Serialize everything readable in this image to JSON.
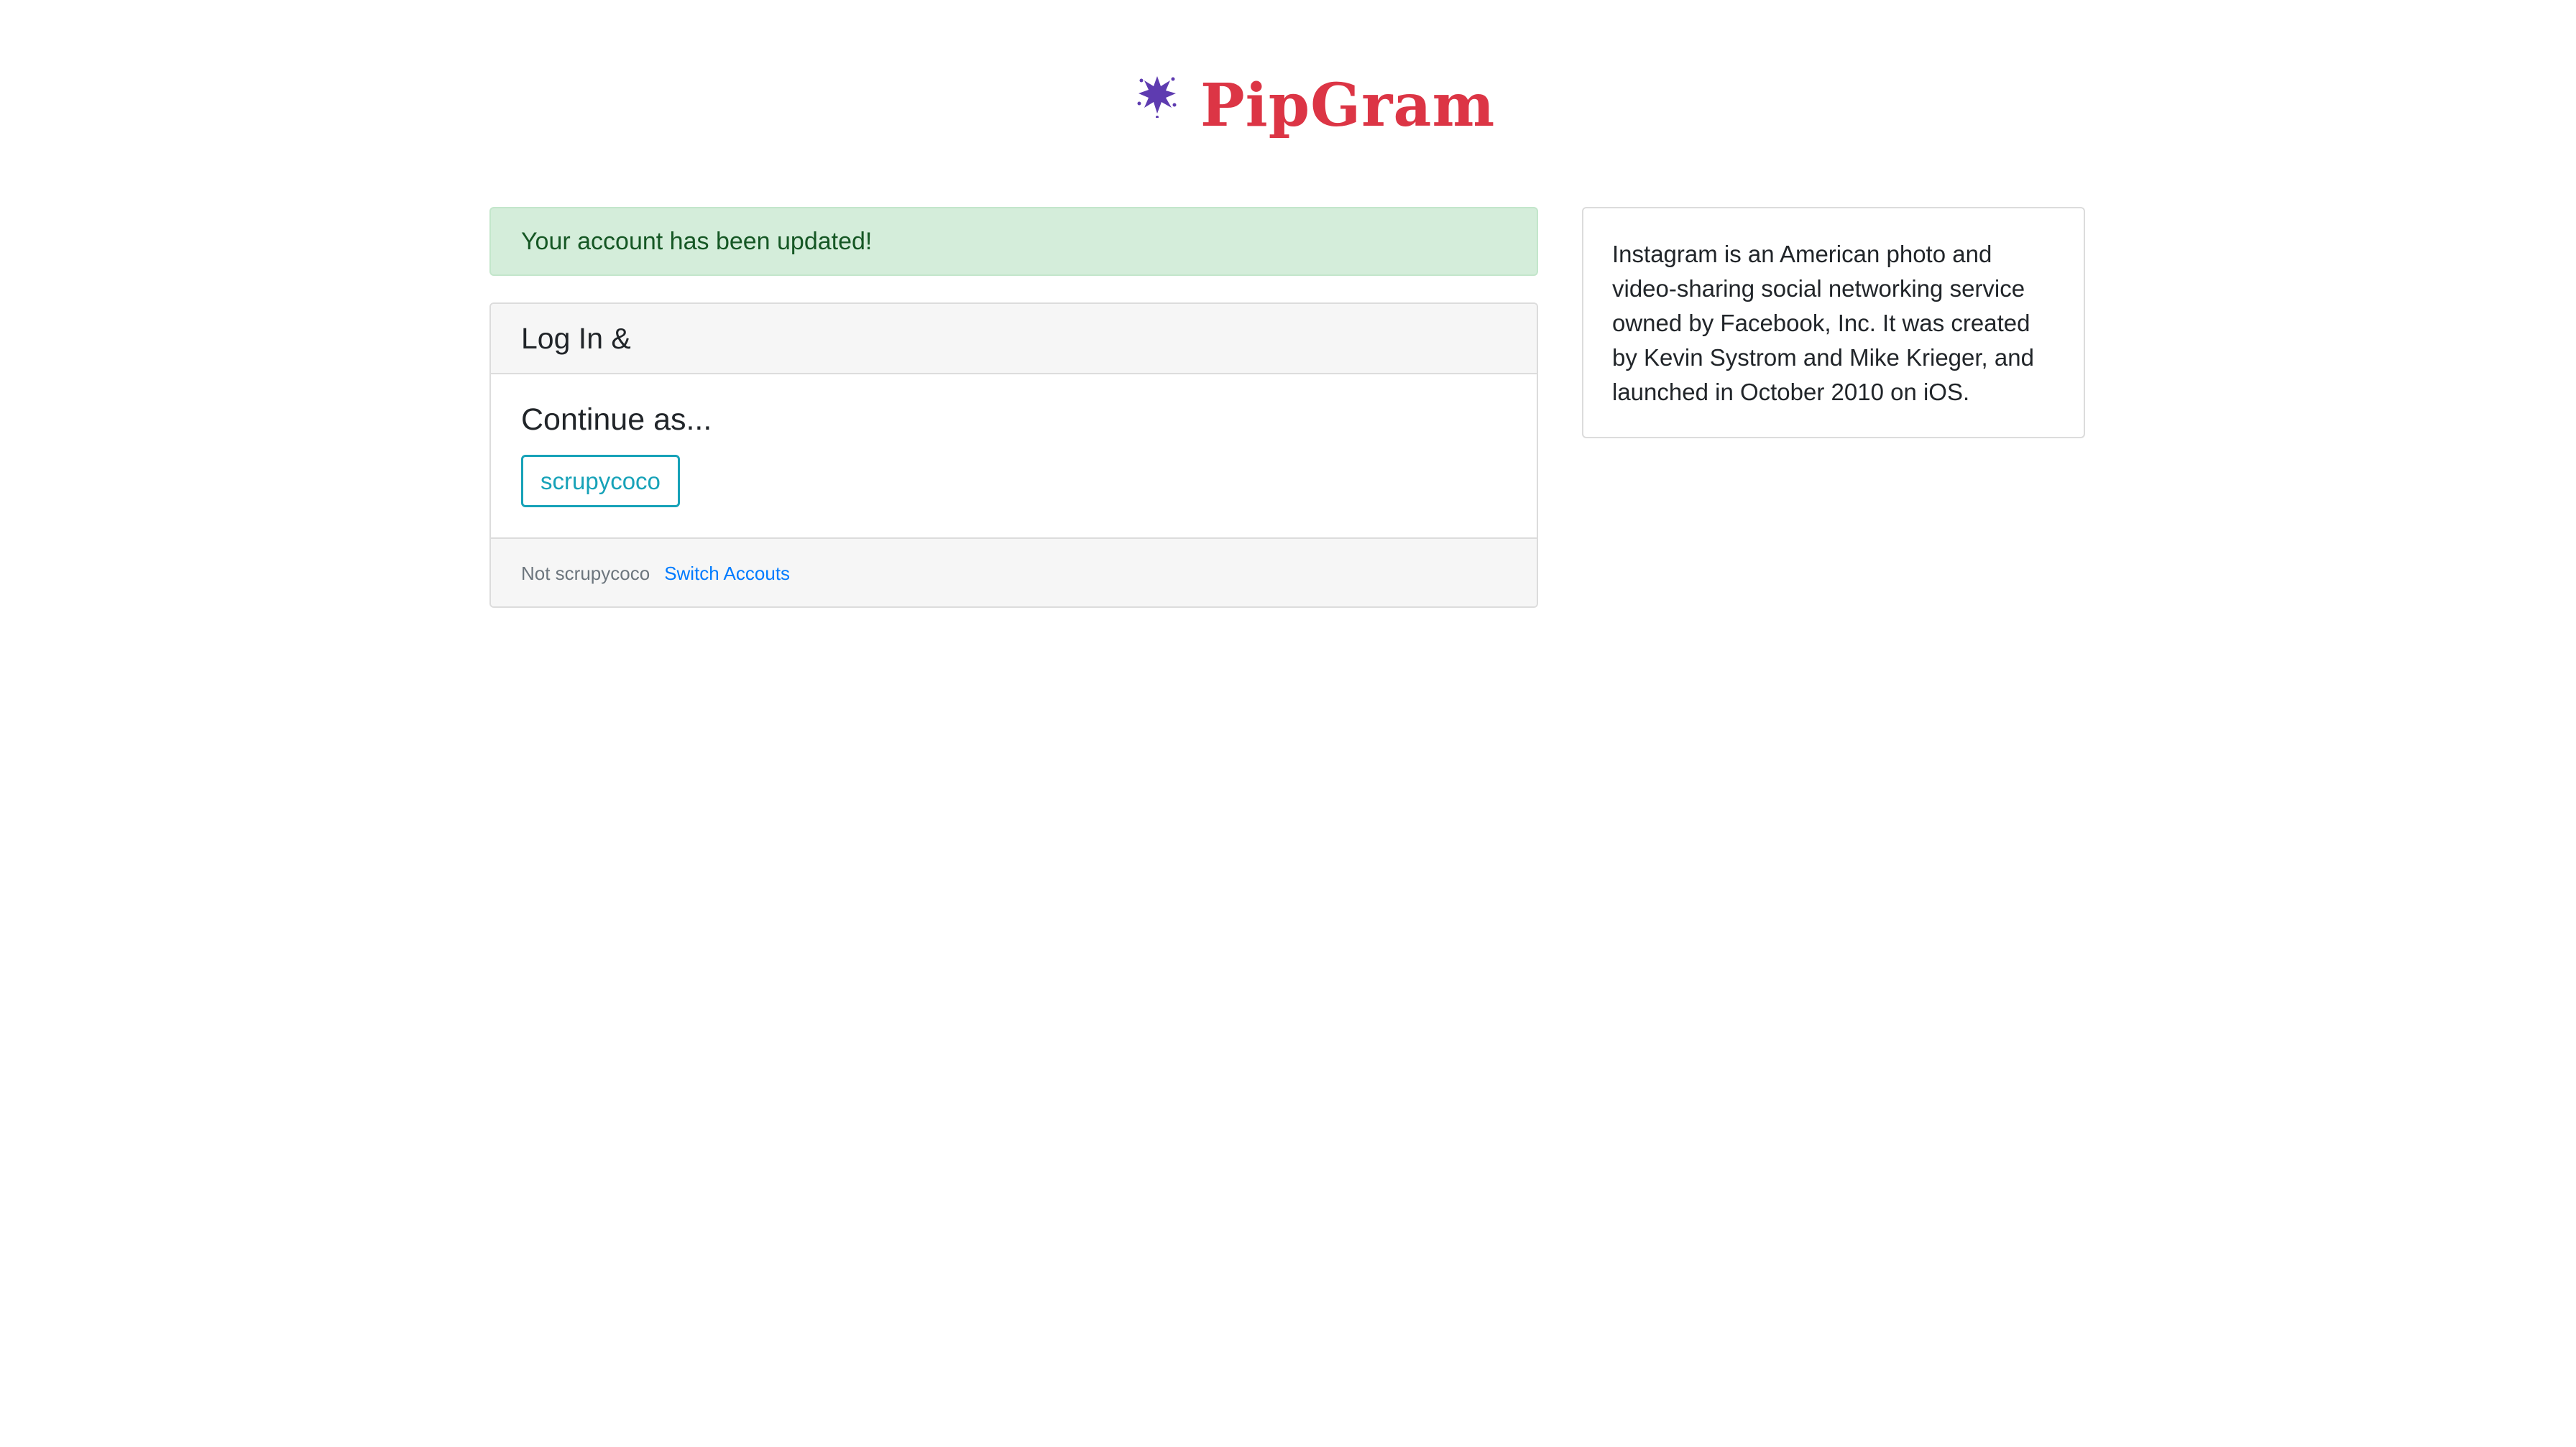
{
  "brand": {
    "name": "PipGram",
    "icon": "splat-icon",
    "colors": {
      "text": "#dc3545",
      "icon": "#5e3bb0"
    }
  },
  "alert": {
    "message": "Your account has been updated!"
  },
  "login_card": {
    "header": "Log In &",
    "continue_heading": "Continue as...",
    "account_button": "scrupycoco",
    "footer_text": "Not scrupycoco",
    "switch_link": "Switch Accouts"
  },
  "info": {
    "text": "Instagram is an American photo and video-sharing social networking service owned by Facebook, Inc. It was created by Kevin Systrom and Mike Krieger, and launched in October 2010 on iOS."
  }
}
